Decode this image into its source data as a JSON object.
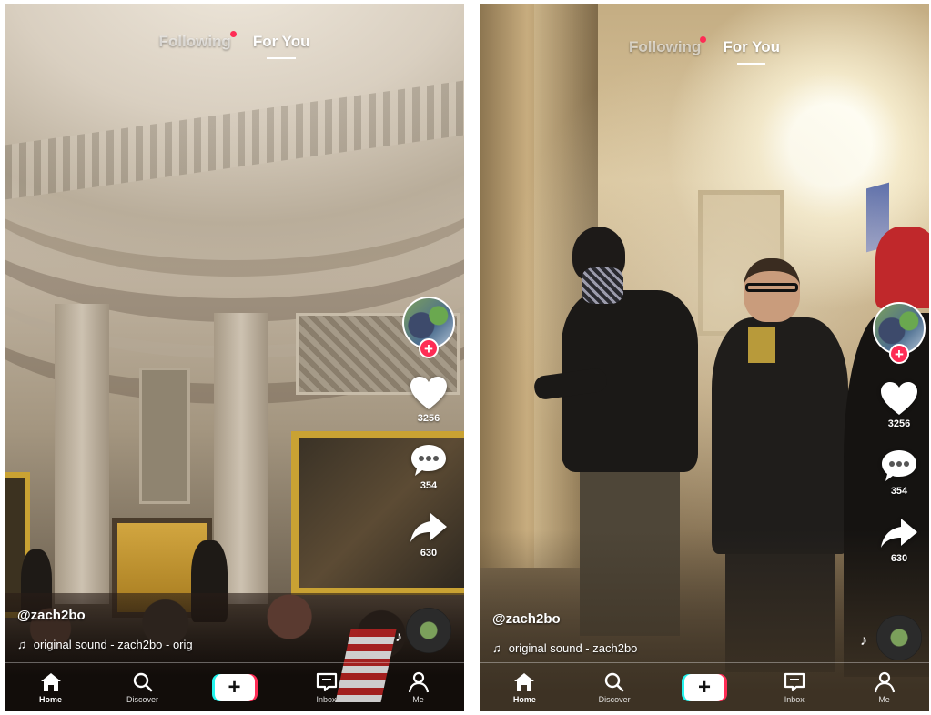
{
  "screens": [
    {
      "tabs": {
        "following": "Following",
        "for_you": "For You"
      },
      "side_rail": {
        "likes_count": "3256",
        "comments_count": "354",
        "shares_count": "630"
      },
      "caption": {
        "username": "@zach2bo",
        "sound": "original sound - zach2bo - orig"
      },
      "nav": {
        "home": "Home",
        "discover": "Discover",
        "create": "+",
        "inbox": "Inbox",
        "me": "Me"
      }
    },
    {
      "tabs": {
        "following": "Following",
        "for_you": "For You"
      },
      "side_rail": {
        "likes_count": "3256",
        "comments_count": "354",
        "shares_count": "630"
      },
      "caption": {
        "username": "@zach2bo",
        "sound": "original sound - zach2bo"
      },
      "nav": {
        "home": "Home",
        "discover": "Discover",
        "create": "+",
        "inbox": "Inbox",
        "me": "Me"
      }
    }
  ],
  "colors": {
    "accent": "#fe2c55",
    "cyan": "#25f4ee",
    "text": "#ffffff"
  },
  "icons": [
    "heart-icon",
    "comment-icon",
    "share-icon",
    "music-note-icon",
    "home-icon",
    "search-icon",
    "inbox-icon",
    "profile-icon"
  ]
}
